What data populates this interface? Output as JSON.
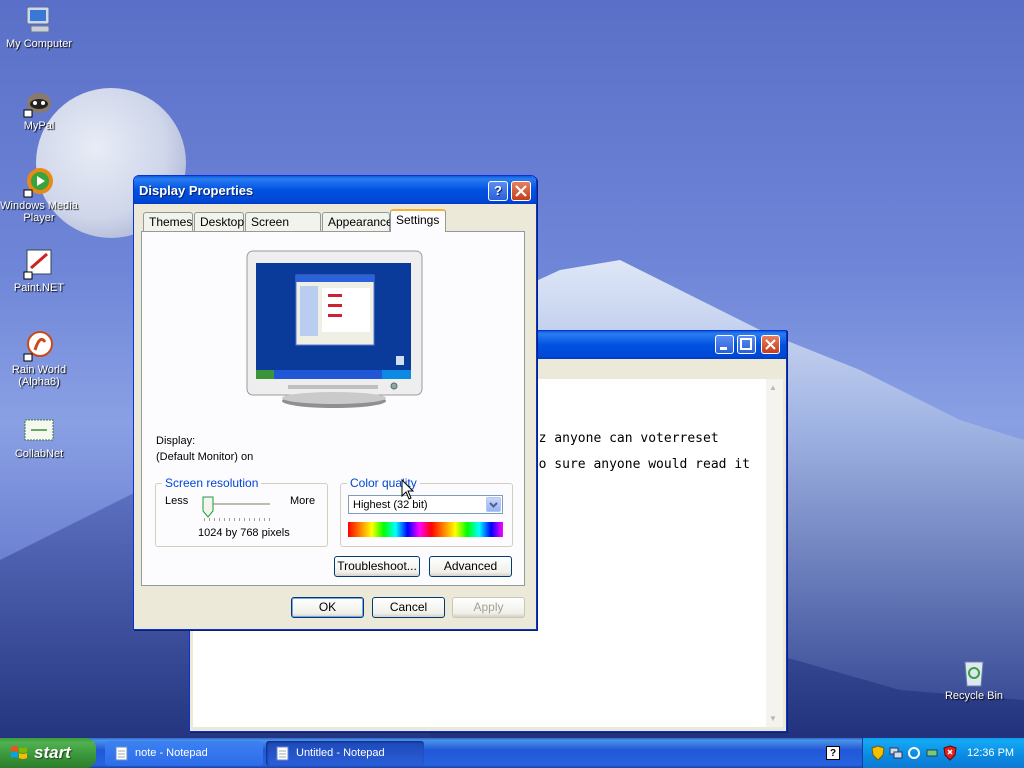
{
  "desktop": {
    "icons": [
      {
        "label": "My Computer",
        "icon": "computer-icon"
      },
      {
        "label": "MyPal",
        "icon": "raccoon-icon"
      },
      {
        "label": "Windows Media Player",
        "icon": "media-player-icon"
      },
      {
        "label": "Paint.NET",
        "icon": "paint-icon"
      },
      {
        "label": "Rain World (Alpha8)",
        "icon": "game-icon"
      },
      {
        "label": "CollabNet",
        "icon": "collabnet-icon"
      },
      {
        "label": "Recycle Bin",
        "icon": "recycle-bin-icon"
      }
    ]
  },
  "notepad": {
    "lines": [
      "tuz anyone can voterreset",
      "too sure anyone would read it"
    ]
  },
  "dialog": {
    "title": "Display Properties",
    "tabs": [
      "Themes",
      "Desktop",
      "Screen Saver",
      "Appearance",
      "Settings"
    ],
    "active_tab": "Settings",
    "display_label": "Display:",
    "display_value": "(Default Monitor) on",
    "resolution": {
      "group_label": "Screen resolution",
      "less": "Less",
      "more": "More",
      "value_text": "1024 by 768 pixels"
    },
    "color": {
      "group_label": "Color quality",
      "selected": "Highest (32 bit)"
    },
    "buttons": {
      "troubleshoot": "Troubleshoot...",
      "advanced": "Advanced",
      "ok": "OK",
      "cancel": "Cancel",
      "apply": "Apply"
    }
  },
  "taskbar": {
    "start": "start",
    "tasks": [
      {
        "label": "note - Notepad"
      },
      {
        "label": "Untitled - Notepad"
      }
    ],
    "clock": "12:36 PM"
  },
  "colors": {
    "title_blue": "#0052e0",
    "taskbar_blue": "#2157d7",
    "start_green": "#3a953a",
    "tab_highlight": "#f6b135"
  }
}
